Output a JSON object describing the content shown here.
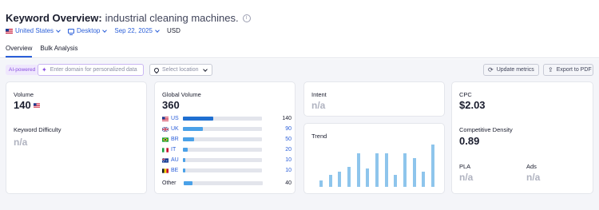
{
  "header": {
    "title_prefix": "Keyword Overview:",
    "keyword": "industrial cleaning machines.",
    "info_icon": "info-circle-icon"
  },
  "filters": {
    "country": "United States",
    "device": "Desktop",
    "date": "Sep 22, 2025",
    "currency": "USD"
  },
  "tabs": [
    {
      "label": "Overview",
      "active": true
    },
    {
      "label": "Bulk Analysis",
      "active": false
    }
  ],
  "toolbar": {
    "ai_badge": "AI-powered",
    "domain_placeholder": "Enter domain for personalized data",
    "location_placeholder": "Select location",
    "update_button": "Update metrics",
    "export_button": "Export to PDF"
  },
  "volume_card": {
    "volume_label": "Volume",
    "volume_value": "140",
    "kd_label": "Keyword Difficulty",
    "kd_value": "n/a"
  },
  "global_card": {
    "label": "Global Volume",
    "value": "360",
    "countries": [
      {
        "code": "US",
        "value": "140",
        "share": 0.38
      },
      {
        "code": "UK",
        "value": "90",
        "share": 0.25
      },
      {
        "code": "BR",
        "value": "50",
        "share": 0.14
      },
      {
        "code": "IT",
        "value": "20",
        "share": 0.06
      },
      {
        "code": "AU",
        "value": "10",
        "share": 0.03
      },
      {
        "code": "BE",
        "value": "10",
        "share": 0.03
      }
    ],
    "other_label": "Other",
    "other_value": "40",
    "other_share": 0.11
  },
  "intent_card": {
    "label": "Intent",
    "value": "n/a"
  },
  "trend_card": {
    "label": "Trend",
    "values": [
      0.2,
      0.35,
      0.45,
      0.6,
      1.0,
      0.55,
      1.0,
      1.0,
      0.35,
      1.0,
      0.85,
      0.45,
      1.25
    ]
  },
  "cpc_card": {
    "cpc_label": "CPC",
    "cpc_value": "$2.03",
    "density_label": "Competitive Density",
    "density_value": "0.89",
    "pla_label": "PLA",
    "pla_value": "n/a",
    "ads_label": "Ads",
    "ads_value": "n/a"
  },
  "colors": {
    "accent": "#2b5fd9",
    "bar_primary": "#1f6fd1",
    "bar_secondary": "#4aa1e8",
    "trend_bar": "#8ec5ec",
    "na_text": "#b0b3c0",
    "ai_purple": "#8a4fe0"
  }
}
